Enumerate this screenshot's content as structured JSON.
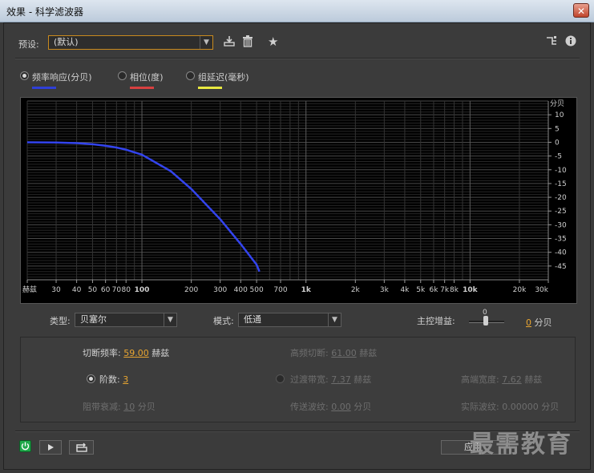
{
  "window": {
    "title": "效果 - 科学滤波器",
    "close_label": "✕"
  },
  "preset": {
    "label": "预设:",
    "value": "(默认)",
    "icons": [
      "save-preset-icon",
      "delete-icon",
      "favorite-star-icon",
      "routing-icon",
      "info-icon"
    ]
  },
  "views": [
    {
      "label": "频率响应(分贝)",
      "selected": true,
      "color": "#2f3fd8"
    },
    {
      "label": "相位(度)",
      "selected": false,
      "color": "#d84040"
    },
    {
      "label": "组延迟(毫秒)",
      "selected": false,
      "color": "#e8e840"
    }
  ],
  "chart_data": {
    "type": "line",
    "x_scale": "log",
    "xlim": [
      20,
      30000
    ],
    "ylim": [
      -50,
      15
    ],
    "x_tick_labels": [
      "赫兹",
      "30",
      "40",
      "50",
      "60",
      "70",
      "80",
      "100",
      "200",
      "300",
      "400",
      "500",
      "700",
      "1k",
      "2k",
      "3k",
      "4k",
      "5k",
      "6k",
      "7k",
      "8k",
      "10k",
      "20k",
      "30k"
    ],
    "y_ticks": [
      10,
      5,
      0,
      -5,
      -10,
      -15,
      -20,
      -25,
      -30,
      -35,
      -40,
      -45
    ],
    "y_unit": "分贝",
    "grid": true,
    "series": [
      {
        "color": "#3344ee",
        "x": [
          20,
          30,
          40,
          50,
          59,
          70,
          80,
          100,
          150,
          200,
          300,
          400,
          500,
          520
        ],
        "y": [
          0,
          -0.1,
          -0.3,
          -0.7,
          -1.2,
          -1.9,
          -2.7,
          -4.5,
          -10.5,
          -17,
          -28,
          -37,
          -44.5,
          -47
        ]
      }
    ]
  },
  "type_field": {
    "label": "类型:",
    "value": "贝塞尔"
  },
  "mode_field": {
    "label": "模式:",
    "value": "低通"
  },
  "master_gain": {
    "label": "主控增益:",
    "slider_label": "0",
    "value": "0",
    "unit": "分贝"
  },
  "params": {
    "cutoff": {
      "label": "切断频率:",
      "value": "59.00",
      "unit": "赫兹"
    },
    "high_cutoff": {
      "label": "高频切断:",
      "value": "61.00",
      "unit": "赫兹"
    },
    "order": {
      "label": "阶数:",
      "value": "3"
    },
    "transition": {
      "label": "过渡带宽:",
      "value": "7.37",
      "unit": "赫兹"
    },
    "high_width": {
      "label": "高端宽度:",
      "value": "7.62",
      "unit": "赫兹"
    },
    "stop_atten": {
      "label": "阻带衰减:",
      "value": "10",
      "unit": "分贝"
    },
    "pass_ripple": {
      "label": "传送波纹:",
      "value": "0.00",
      "unit": "分贝"
    },
    "actual_ripple": {
      "label": "实际波纹:",
      "value": "0.00000",
      "unit": "分贝"
    }
  },
  "footer": {
    "apply_label": "应用",
    "watermark": "最需教育"
  }
}
